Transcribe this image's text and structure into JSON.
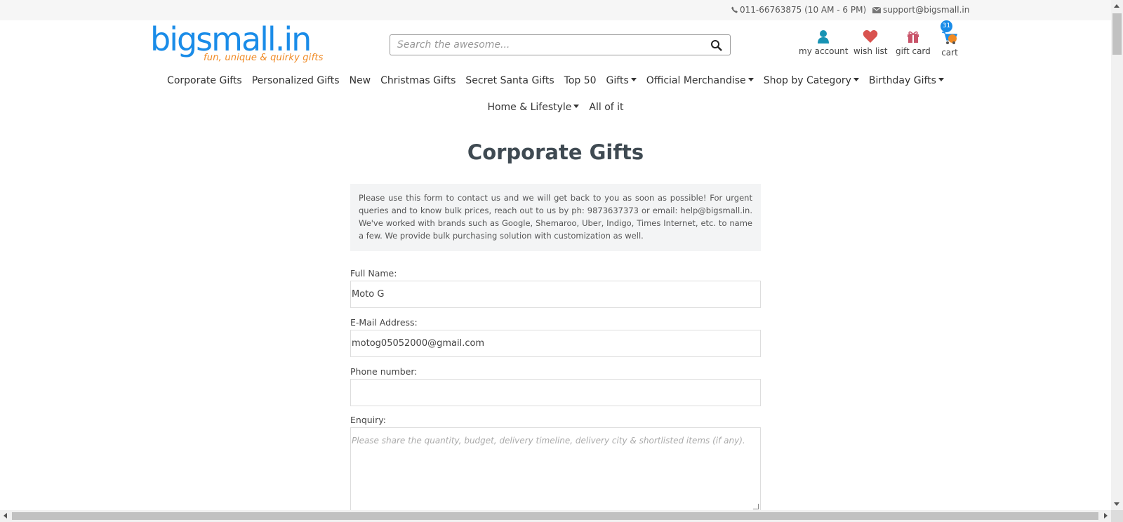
{
  "topbar": {
    "phone": "011-66763875 (10 AM - 6 PM)",
    "email": "support@bigsmall.in"
  },
  "logo": {
    "main": "bigsmall.in",
    "tagline": "fun, unique & quirky gifts"
  },
  "search": {
    "placeholder": "Search the awesome..."
  },
  "header_icons": {
    "account": "my account",
    "wishlist": "wish list",
    "giftcard": "gift card",
    "cart": "cart",
    "cart_count": "31"
  },
  "nav": {
    "row1": [
      {
        "label": "Corporate Gifts",
        "dropdown": false
      },
      {
        "label": "Personalized Gifts",
        "dropdown": false
      },
      {
        "label": "New",
        "dropdown": false
      },
      {
        "label": "Christmas Gifts",
        "dropdown": false
      },
      {
        "label": "Secret Santa Gifts",
        "dropdown": false
      },
      {
        "label": "Top 50",
        "dropdown": false
      },
      {
        "label": "Gifts",
        "dropdown": true
      },
      {
        "label": "Official Merchandise",
        "dropdown": true
      },
      {
        "label": "Shop by Category",
        "dropdown": true
      },
      {
        "label": "Birthday Gifts",
        "dropdown": true
      }
    ],
    "row2": [
      {
        "label": "Home & Lifestyle",
        "dropdown": true
      },
      {
        "label": "All of it",
        "dropdown": false
      }
    ]
  },
  "page": {
    "title": "Corporate Gifts",
    "info": "Please use this form to contact us and we will get back to you as soon as possible! For urgent queries and to know bulk prices, reach out to us by ph: 9873637373 or email: help@bigsmall.in. We've worked with brands such as Google, Shemaroo, Uber, Indigo, Times Internet, etc. to name a few. We provide bulk purchasing solution with customization as well."
  },
  "form": {
    "name_label": "Full Name:",
    "name_value": "Moto G",
    "email_label": "E-Mail Address:",
    "email_value": "motog05052000@gmail.com",
    "phone_label": "Phone number:",
    "phone_value": "",
    "enquiry_label": "Enquiry:",
    "enquiry_placeholder": "Please share the quantity, budget, delivery timeline, delivery city & shortlisted items (if any)."
  },
  "colors": {
    "brand_blue": "#1a8ce8",
    "brand_orange": "#f08a24",
    "wishlist_red": "#d9534f",
    "account_teal": "#1793b4"
  }
}
